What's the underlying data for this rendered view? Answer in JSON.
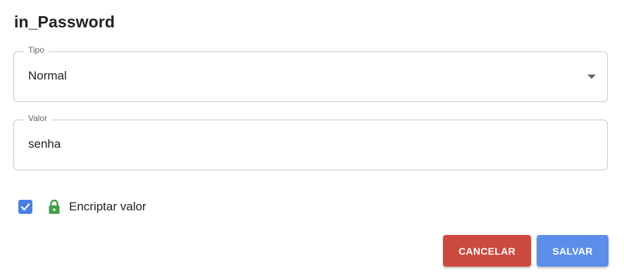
{
  "dialog": {
    "title": "in_Password"
  },
  "tipo": {
    "label": "Tipo",
    "selected": "Normal"
  },
  "valor": {
    "label": "Valor",
    "value": "senha"
  },
  "encrypt": {
    "checked": true,
    "label": "Encriptar valor",
    "icon": "lock-icon"
  },
  "actions": {
    "cancel_label": "CANCELAR",
    "save_label": "SALVAR"
  },
  "colors": {
    "checkbox": "#4a7fe0",
    "lock": "#43a047",
    "cancel": "#cc4a3f",
    "save": "#5b8ee8"
  }
}
